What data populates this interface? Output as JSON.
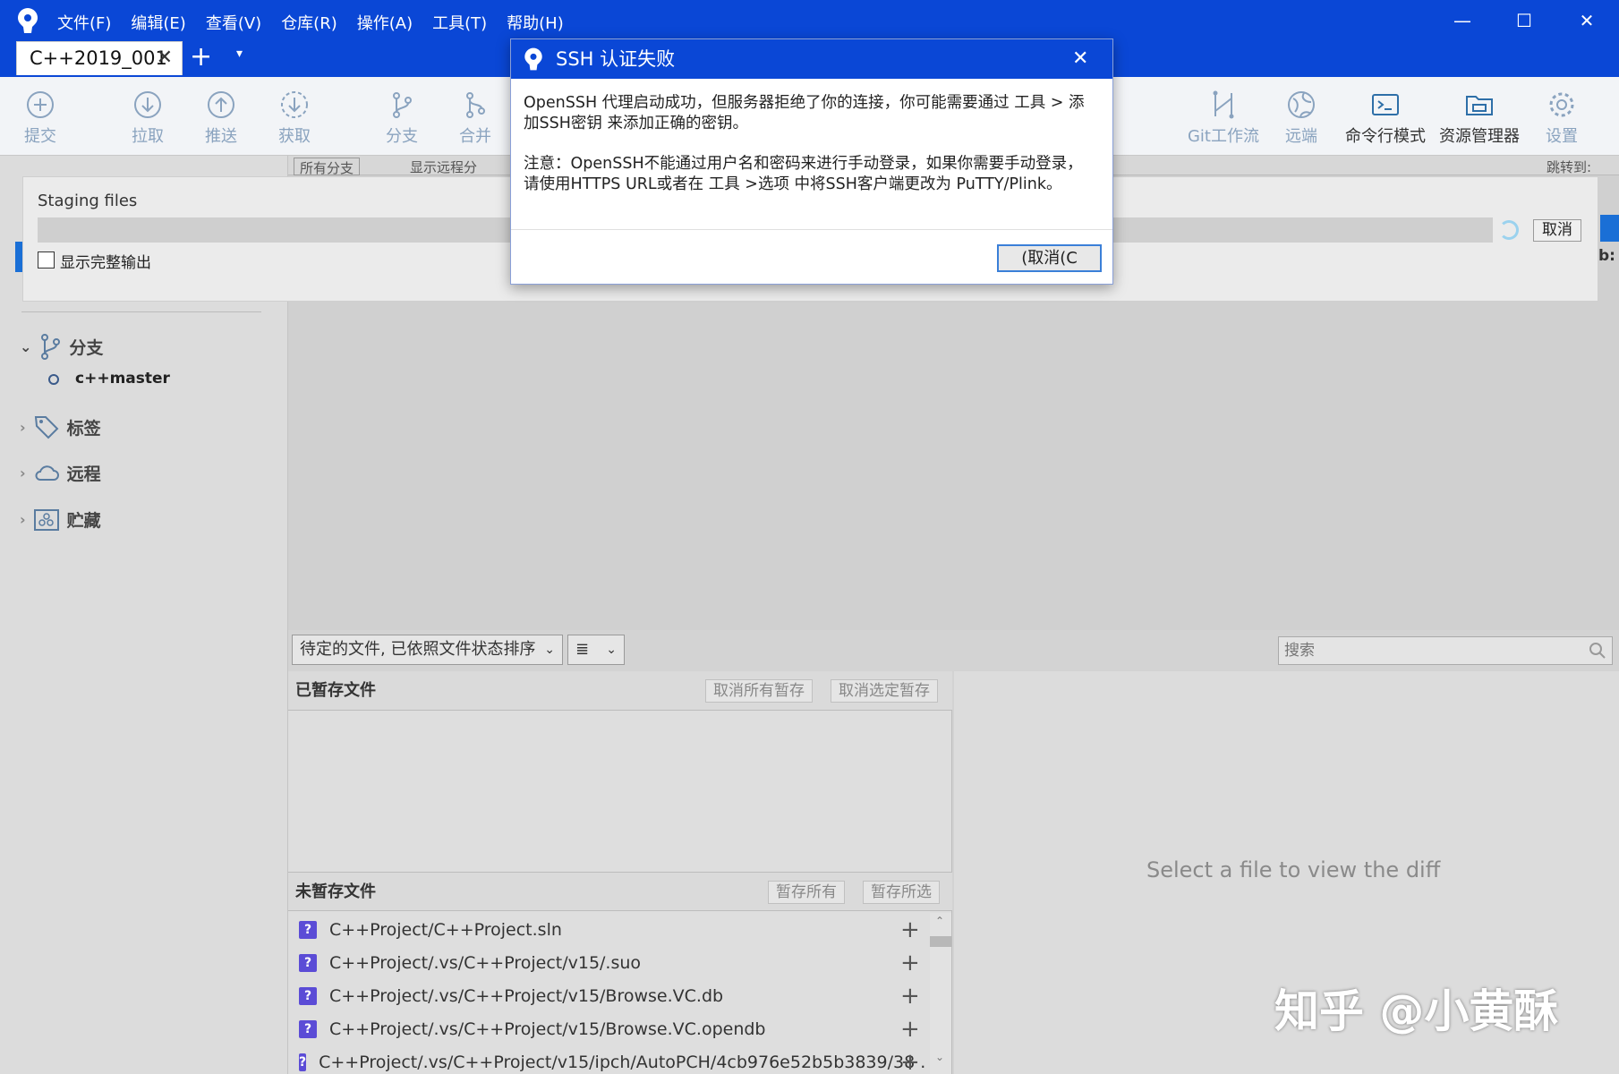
{
  "menu": [
    "文件(F)",
    "编辑(E)",
    "查看(V)",
    "仓库(R)",
    "操作(A)",
    "工具(T)",
    "帮助(H)"
  ],
  "window_controls": {
    "minimize": "—",
    "maximize": "☐",
    "close": "✕"
  },
  "tab": {
    "label": "C++2019_001",
    "close": "✕",
    "new": "+",
    "dropdown": "▾"
  },
  "toolbar": {
    "commit": "提交",
    "pull": "拉取",
    "push": "推送",
    "fetch": "获取",
    "branch": "分支",
    "merge": "合并",
    "gitflow": "Git工作流",
    "remote": "远端",
    "terminal": "命令行模式",
    "explorer": "资源管理器",
    "settings": "设置"
  },
  "filter": {
    "all_branches": "所有分支",
    "show_remote": "显示远程分",
    "jump_to": "跳转到:"
  },
  "staging": {
    "title": "Staging files",
    "cancel": "取消",
    "show_full_output": "显示完整输出",
    "side_hint": "b:"
  },
  "sidebar": {
    "branches": "分支",
    "current_branch": "c++master",
    "tags": "标签",
    "remotes": "远程",
    "stashes": "贮藏"
  },
  "lower": {
    "sort_select": "待定的文件, 已依照文件状态排序",
    "view_select": "≣",
    "search_placeholder": "搜索",
    "staged_header": "已暂存文件",
    "unstage_all": "取消所有暂存",
    "unstage_selected": "取消选定暂存",
    "unstaged_header": "未暂存文件",
    "stage_all": "暂存所有",
    "stage_selected": "暂存所选",
    "diff_hint": "Select a file to view the diff"
  },
  "unstaged_files": [
    "C++Project/C++Project.sln",
    "C++Project/.vs/C++Project/v15/.suo",
    "C++Project/.vs/C++Project/v15/Browse.VC.db",
    "C++Project/.vs/C++Project/v15/Browse.VC.opendb",
    "C++Project/.vs/C++Project/v15/ipch/AutoPCH/4cb976e52b5b3839/38 ..."
  ],
  "dialog": {
    "title": "SSH 认证失败",
    "close": "✕",
    "line1": "OpenSSH 代理启动成功，但服务器拒绝了你的连接，你可能需要通过 工具 > 添",
    "line2": "加SSH密钥 来添加正确的密钥。",
    "line3": "注意：OpenSSH不能通过用户名和密码来进行手动登录，如果你需要手动登录，",
    "line4": "请使用HTTPS URL或者在 工具 >选项 中将SSH客户端更改为 PuTTY/Plink。",
    "cancel": "(取消(C"
  },
  "watermark": "知乎 @小黄酥",
  "colors": {
    "title_blue": "#0a47d6",
    "file_badge": "#5b4cd6"
  }
}
